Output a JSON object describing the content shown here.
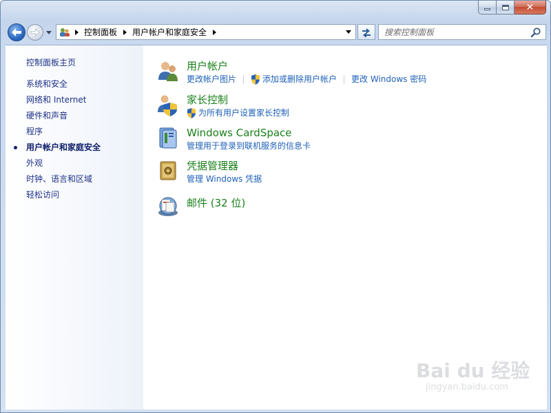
{
  "window": {
    "buttons": {
      "minimize": "minimize-icon",
      "maximize": "maximize-icon",
      "close": "close-icon"
    }
  },
  "nav": {
    "back_icon": "back-arrow-icon",
    "forward_icon": "forward-arrow-icon"
  },
  "address": {
    "breadcrumbs": [
      "控制面板",
      "用户帐户和家庭安全"
    ]
  },
  "search": {
    "placeholder": "搜索控制面板"
  },
  "sidebar": {
    "home": "控制面板主页",
    "items": [
      {
        "label": "系统和安全",
        "active": false
      },
      {
        "label": "网络和 Internet",
        "active": false
      },
      {
        "label": "硬件和声音",
        "active": false
      },
      {
        "label": "程序",
        "active": false
      },
      {
        "label": "用户帐户和家庭安全",
        "active": true
      },
      {
        "label": "外观",
        "active": false
      },
      {
        "label": "时钟、语言和区域",
        "active": false
      },
      {
        "label": "轻松访问",
        "active": false
      }
    ]
  },
  "categories": [
    {
      "title": "用户帐户",
      "icon": "user-accounts-icon",
      "links": [
        {
          "label": "更改帐户图片",
          "shield": false
        },
        {
          "label": "添加或删除用户帐户",
          "shield": true
        },
        {
          "label": "更改 Windows 密码",
          "shield": false
        }
      ]
    },
    {
      "title": "家长控制",
      "icon": "parental-controls-icon",
      "links": [
        {
          "label": "为所有用户设置家长控制",
          "shield": true
        }
      ]
    },
    {
      "title": "Windows CardSpace",
      "icon": "cardspace-icon",
      "links": [
        {
          "label": "管理用于登录到联机服务的信息卡",
          "shield": false
        }
      ]
    },
    {
      "title": "凭据管理器",
      "icon": "credential-manager-icon",
      "links": [
        {
          "label": "管理 Windows 凭据",
          "shield": false
        }
      ]
    },
    {
      "title": "邮件 (32 位)",
      "icon": "mail-icon",
      "links": []
    }
  ],
  "watermark": {
    "brand": "Bai du 经验",
    "url": "jingyan.baidu.com"
  },
  "colors": {
    "category_title": "#1a7f1a",
    "link": "#1e60b8",
    "sidebar_text": "#1e3287"
  }
}
